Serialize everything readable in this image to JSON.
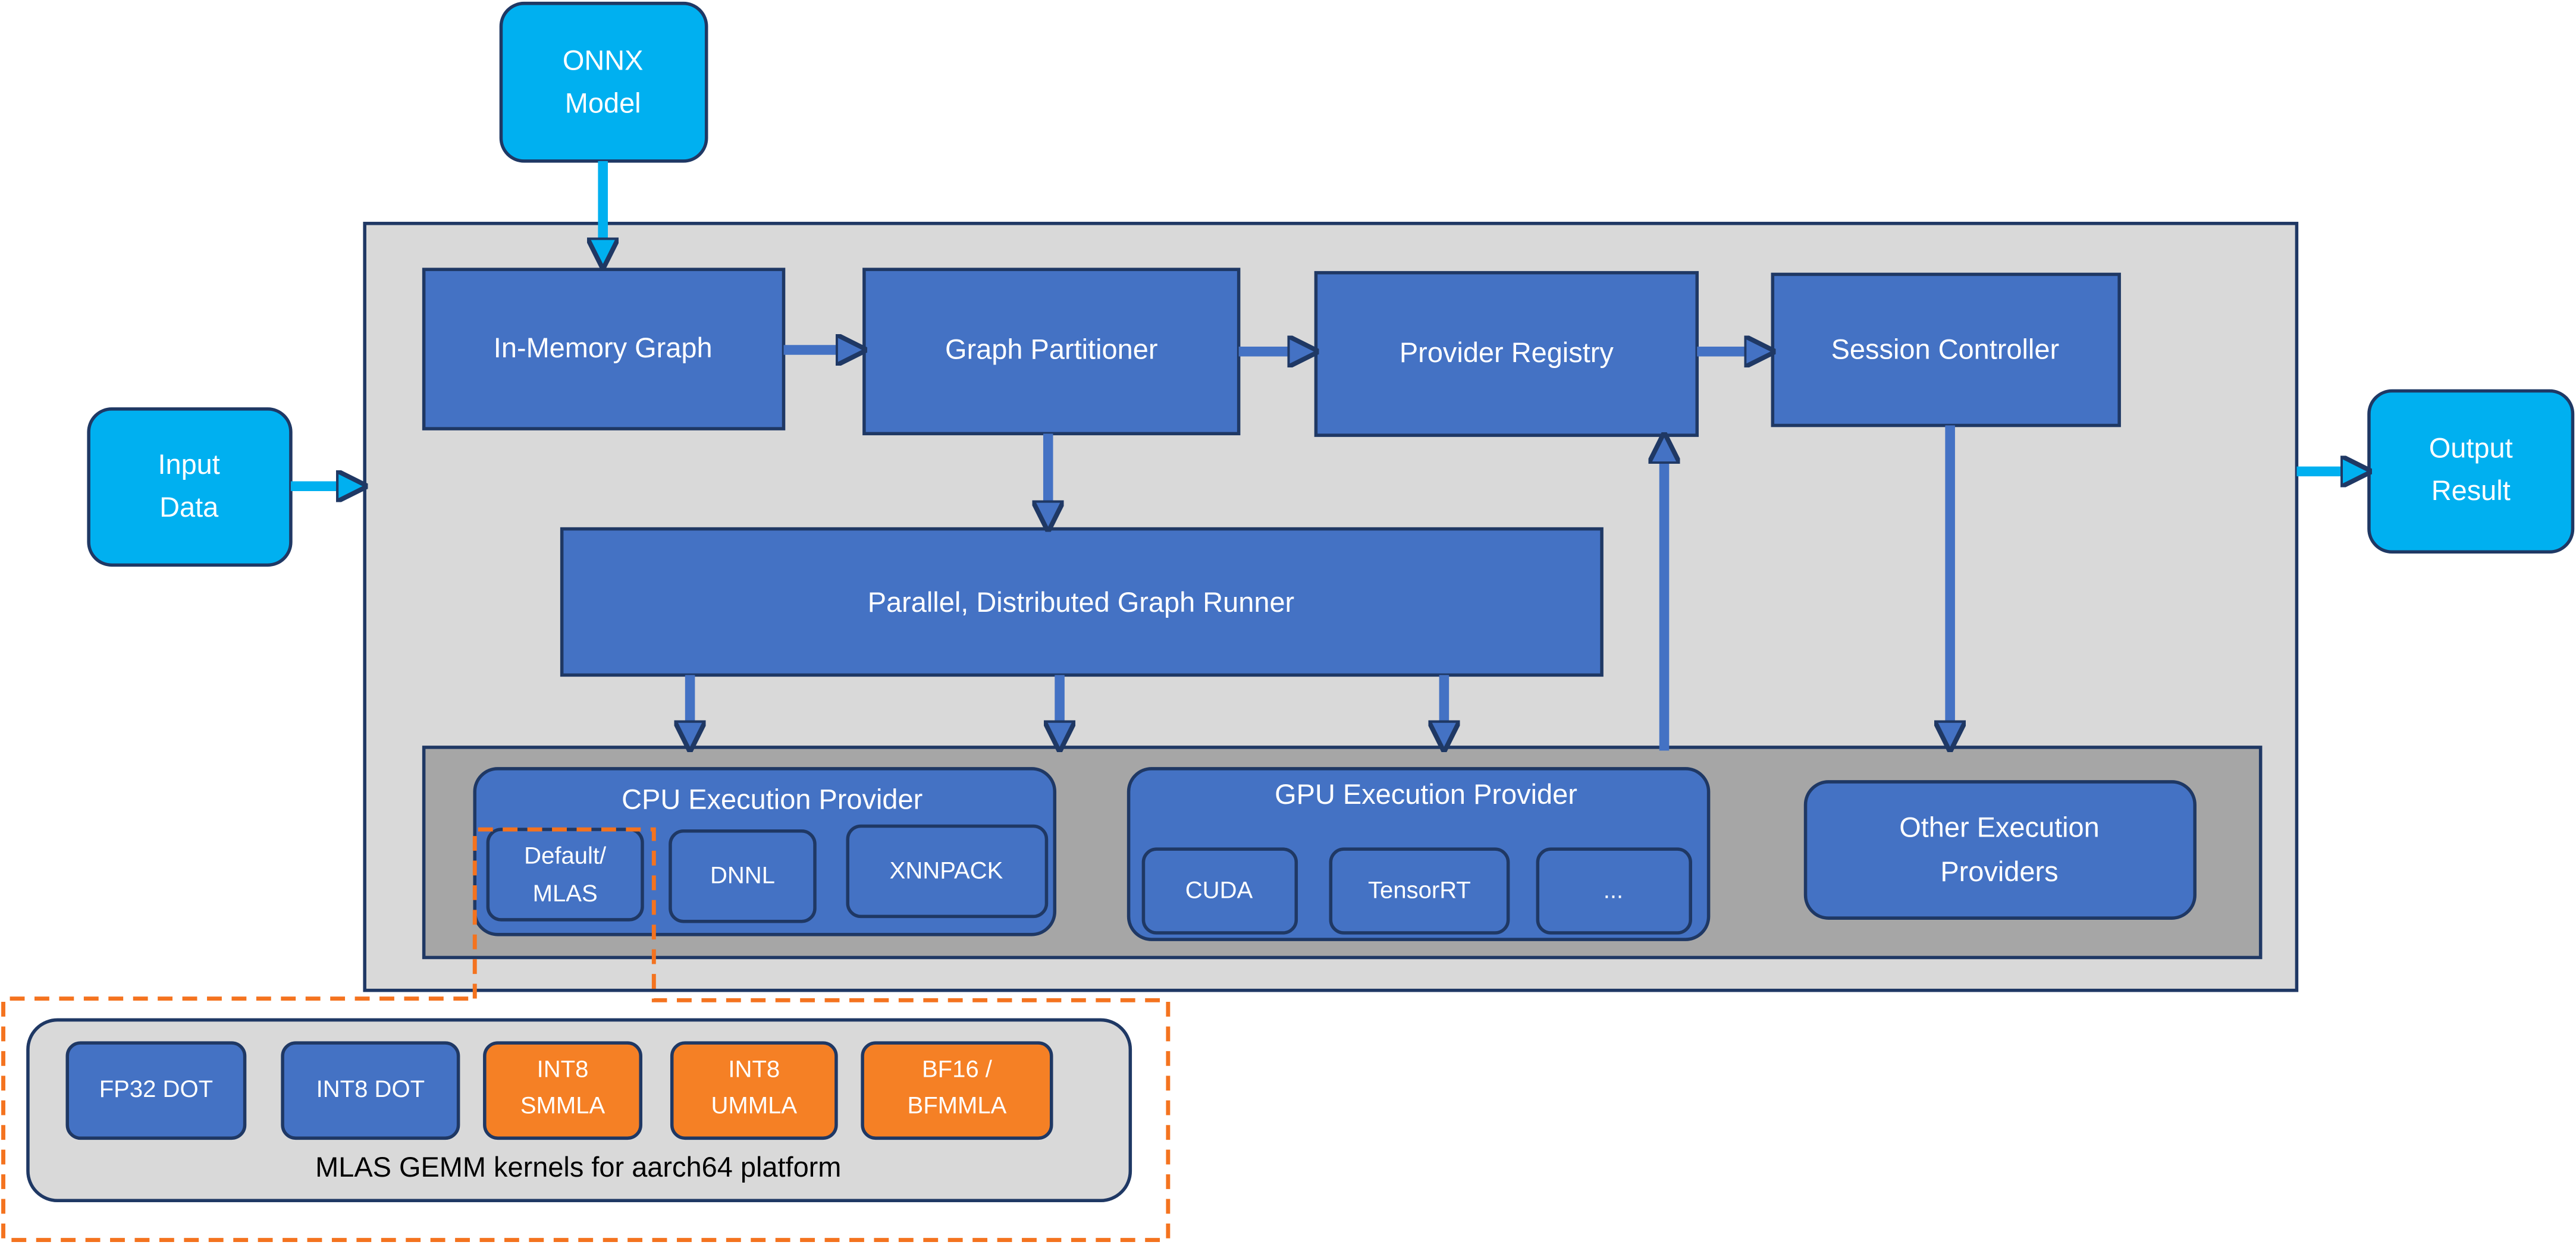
{
  "colors": {
    "block": "#4472C4",
    "io": "#00B0F0",
    "outline": "#1F3864",
    "container": "#D9D9D9",
    "provider_area": "#A6A6A6",
    "highlight": "#F58025",
    "dashed": "#F4731F"
  },
  "inputs": {
    "onnx_model": [
      "ONNX",
      "Model"
    ],
    "input_data": [
      "Input",
      "Data"
    ]
  },
  "output": {
    "output_result": [
      "Output",
      "Result"
    ]
  },
  "core": {
    "in_memory_graph": "In-Memory Graph",
    "graph_partitioner": "Graph Partitioner",
    "provider_registry": "Provider Registry",
    "session_controller": "Session Controller",
    "graph_runner": "Parallel, Distributed Graph Runner"
  },
  "providers": {
    "cpu": {
      "title": "CPU Execution Provider",
      "items": [
        [
          "Default/",
          "MLAS"
        ],
        [
          "DNNL"
        ],
        [
          "XNNPACK"
        ]
      ]
    },
    "gpu": {
      "title": "GPU Execution Provider",
      "items": [
        "CUDA",
        "TensorRT",
        "..."
      ]
    },
    "other": [
      "Other Execution",
      "Providers"
    ]
  },
  "mlas": {
    "caption": "MLAS GEMM kernels for aarch64 platform",
    "kernels": [
      {
        "lines": [
          "FP32 DOT"
        ],
        "highlighted": false
      },
      {
        "lines": [
          "INT8 DOT"
        ],
        "highlighted": false
      },
      {
        "lines": [
          "INT8",
          "SMMLA"
        ],
        "highlighted": true
      },
      {
        "lines": [
          "INT8",
          "UMMLA"
        ],
        "highlighted": true
      },
      {
        "lines": [
          "BF16 /",
          "BFMMLA"
        ],
        "highlighted": true
      }
    ]
  }
}
